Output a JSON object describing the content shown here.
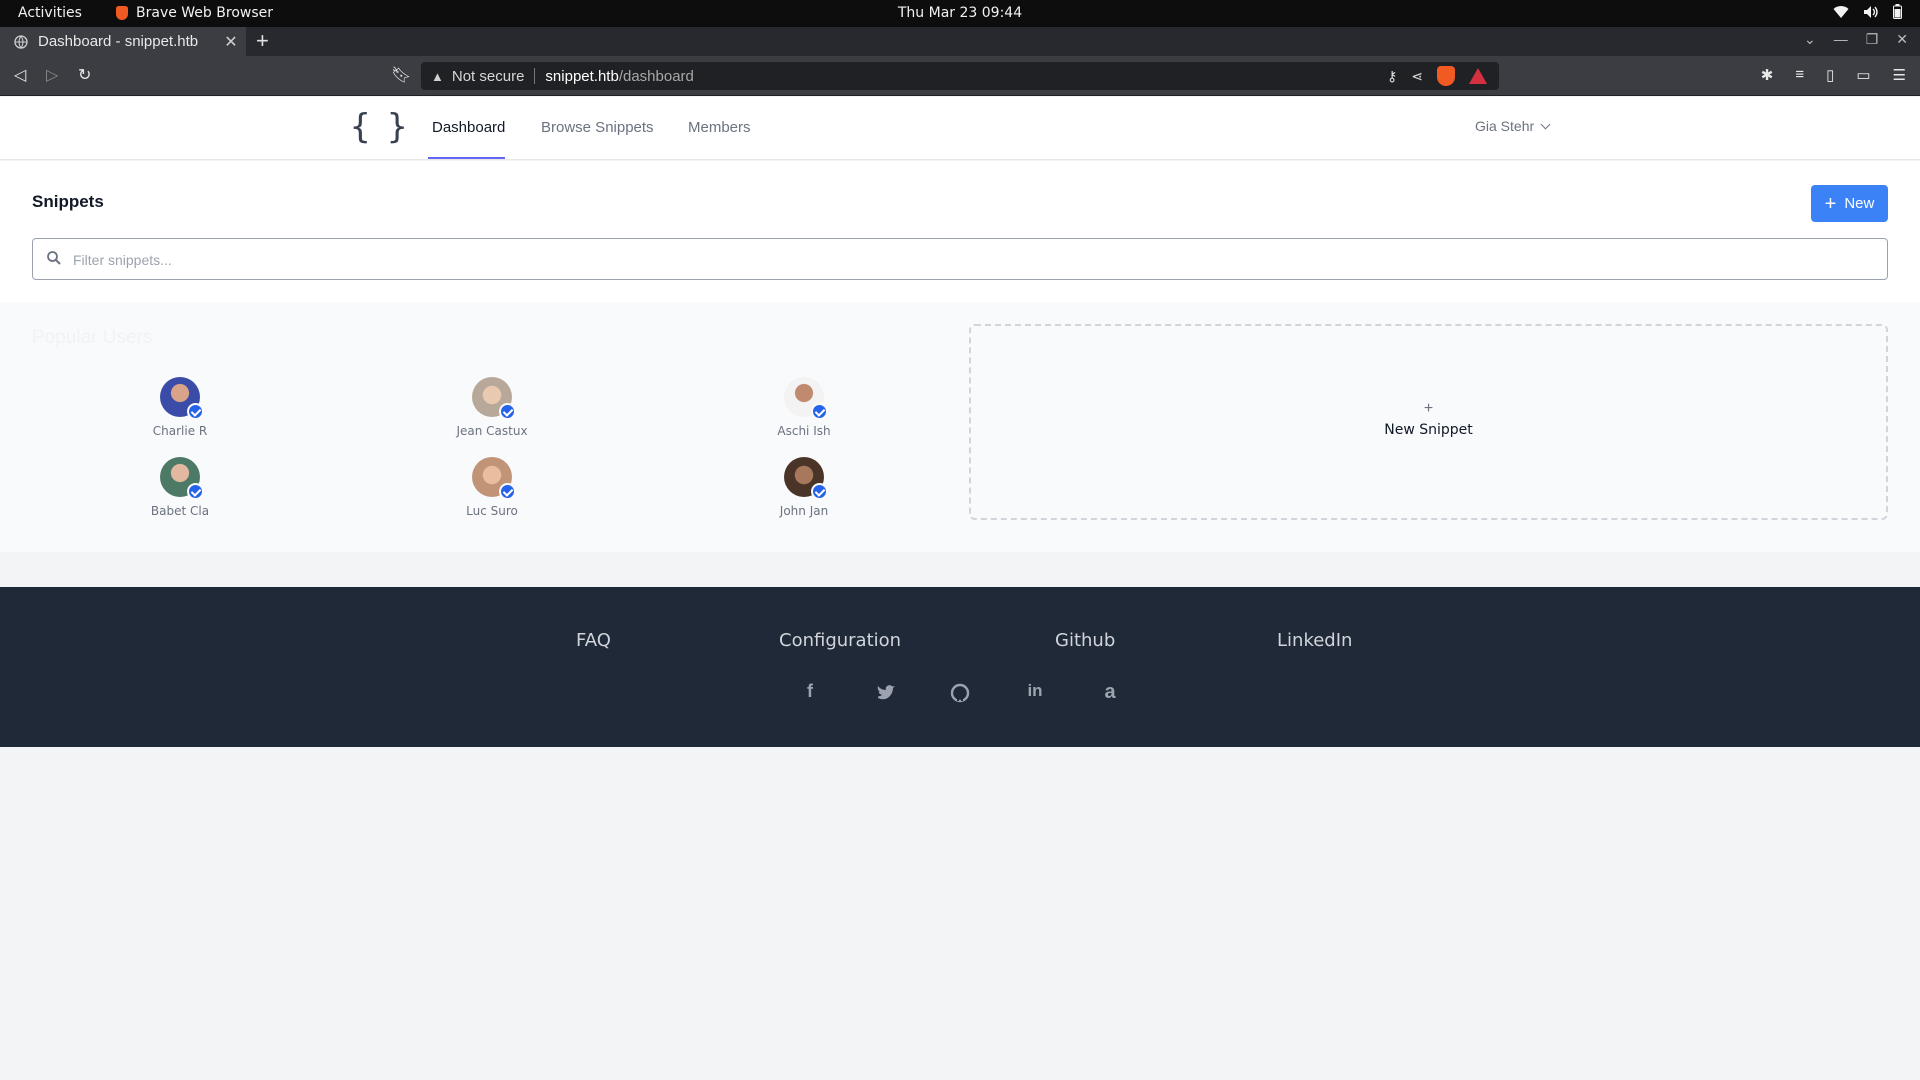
{
  "system_bar": {
    "activities": "Activities",
    "app_name": "Brave Web Browser",
    "clock": "Thu Mar 23  09:44"
  },
  "browser": {
    "tab_title": "Dashboard - snippet.htb",
    "security_label": "Not secure",
    "url_host": "snippet.htb",
    "url_path": "/dashboard"
  },
  "nav": {
    "logo": "{ }",
    "links": [
      "Dashboard",
      "Browse Snippets",
      "Members"
    ],
    "active": "Dashboard",
    "user": "Gia Stehr"
  },
  "main": {
    "title": "Snippets",
    "new_button": "New",
    "search_placeholder": "Filter snippets..."
  },
  "popular": {
    "title": "Popular Users",
    "users": [
      {
        "name": "Charlie R",
        "color": "#3b4ba8"
      },
      {
        "name": "Jean Castux",
        "color": "#b8a89a"
      },
      {
        "name": "Aschi Ish",
        "color": "#7c5a48"
      },
      {
        "name": "Babet Cla",
        "color": "#4d7a66"
      },
      {
        "name": "Luc Suro",
        "color": "#c19478"
      },
      {
        "name": "John Jan",
        "color": "#4a3428"
      }
    ],
    "new_snippet": "New Snippet",
    "new_snippet_plus": "+"
  },
  "footer": {
    "links": [
      "FAQ",
      "Configuration",
      "Github",
      "LinkedIn"
    ],
    "socials": [
      "facebook-icon",
      "twitter-icon",
      "github-icon",
      "linkedin-icon",
      "amazon-icon"
    ]
  },
  "colors": {
    "accent": "#3b82f6",
    "nav_active": "#6366f1",
    "footer_bg": "#1f2937"
  }
}
